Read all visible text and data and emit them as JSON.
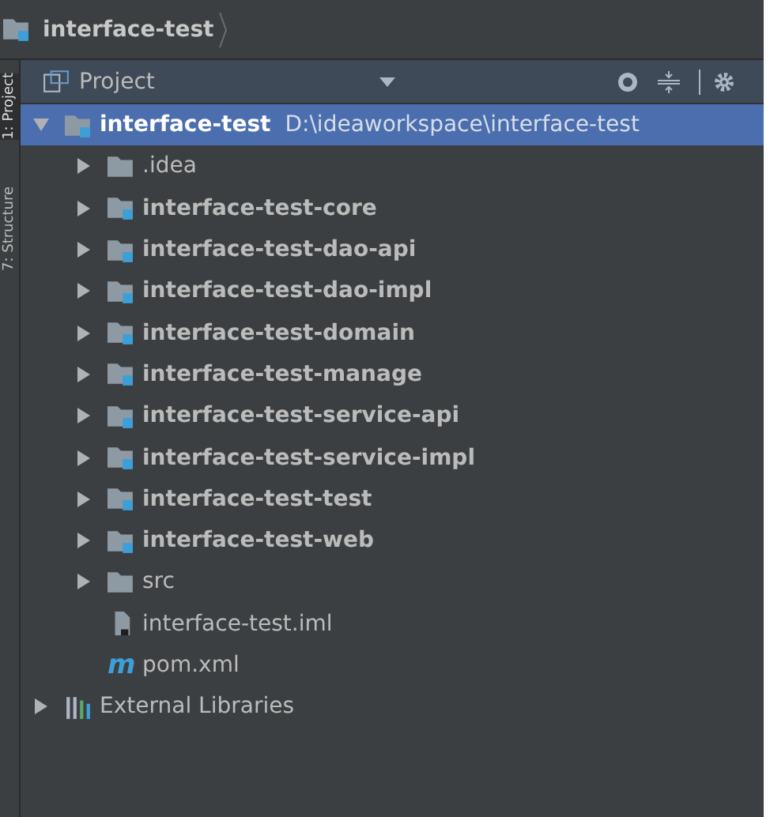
{
  "breadcrumb": {
    "label": "interface-test"
  },
  "side_tabs": [
    {
      "label": "1: Project",
      "selected": true
    },
    {
      "label": "7: Structure",
      "selected": false
    }
  ],
  "panel": {
    "title": "Project"
  },
  "tree": [
    {
      "kind": "module",
      "label": "interface-test",
      "path": "D:\\ideaworkspace\\interface-test",
      "expanded": true,
      "selected": true,
      "children": [
        {
          "kind": "folder",
          "label": ".idea",
          "expanded": false,
          "selected": false
        },
        {
          "kind": "module",
          "label": "interface-test-core",
          "expanded": false,
          "selected": false
        },
        {
          "kind": "module",
          "label": "interface-test-dao-api",
          "expanded": false,
          "selected": false
        },
        {
          "kind": "module",
          "label": "interface-test-dao-impl",
          "expanded": false,
          "selected": false
        },
        {
          "kind": "module",
          "label": "interface-test-domain",
          "expanded": false,
          "selected": false
        },
        {
          "kind": "module",
          "label": "interface-test-manage",
          "expanded": false,
          "selected": false
        },
        {
          "kind": "module",
          "label": "interface-test-service-api",
          "expanded": false,
          "selected": false
        },
        {
          "kind": "module",
          "label": "interface-test-service-impl",
          "expanded": false,
          "selected": false
        },
        {
          "kind": "module",
          "label": "interface-test-test",
          "expanded": false,
          "selected": false
        },
        {
          "kind": "module",
          "label": "interface-test-web",
          "expanded": false,
          "selected": false
        },
        {
          "kind": "folder",
          "label": "src",
          "expanded": false,
          "selected": false
        },
        {
          "kind": "iml",
          "label": "interface-test.iml",
          "selected": false
        },
        {
          "kind": "maven",
          "icon_text": "m",
          "label": "pom.xml",
          "selected": false
        }
      ]
    },
    {
      "kind": "libraries",
      "label": "External Libraries",
      "expanded": false,
      "selected": false
    }
  ]
}
